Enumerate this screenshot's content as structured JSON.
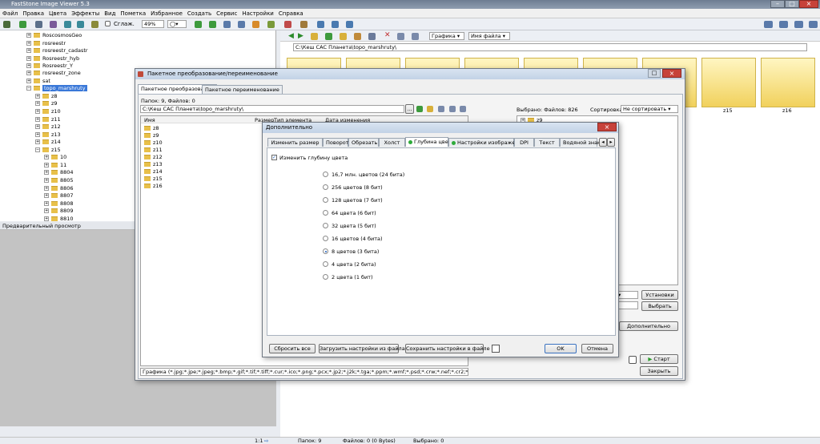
{
  "app": {
    "title": "FastStone Image Viewer 5.3"
  },
  "menu": [
    "Файл",
    "Правка",
    "Цвета",
    "Эффекты",
    "Вид",
    "Пометка",
    "Избранное",
    "Создать",
    "Сервис",
    "Настройки",
    "Справка"
  ],
  "toolbar": {
    "smooth_label": "Сглаж.",
    "zoom_value": "49%"
  },
  "browser": {
    "filter_value": "Графика",
    "sort_value": "Имя файла",
    "path": "C:\\Кеш САС Планета\\topo_marshruty\\"
  },
  "tree": [
    {
      "label": "RoscosmosGeo"
    },
    {
      "label": "rosreestr"
    },
    {
      "label": "rosreestr_cadastr"
    },
    {
      "label": "Rosreestr_hyb"
    },
    {
      "label": "Rosreestr_Y"
    },
    {
      "label": "rosreestr_zone"
    },
    {
      "label": "sat"
    },
    {
      "label": "topo_marshruty"
    },
    {
      "label": "z8"
    },
    {
      "label": "z9"
    },
    {
      "label": "z10"
    },
    {
      "label": "z11"
    },
    {
      "label": "z12"
    },
    {
      "label": "z13"
    },
    {
      "label": "z14"
    },
    {
      "label": "z15"
    },
    {
      "label": "10"
    },
    {
      "label": "11"
    },
    {
      "label": "8804"
    },
    {
      "label": "8805"
    },
    {
      "label": "8806"
    },
    {
      "label": "8807"
    },
    {
      "label": "8808"
    },
    {
      "label": "8809"
    },
    {
      "label": "8810"
    }
  ],
  "preview": {
    "header": "Предварительный просмотр"
  },
  "thumbs": {
    "z15": "z15",
    "z16": "z16"
  },
  "status": {
    "page": "1:1",
    "folders": "Папок: 9",
    "files": "Файлов: 0 (0 Bytes)",
    "selected": "Выбрано: 0"
  },
  "batch": {
    "title": "Пакетное преобразование/переименование",
    "tab_convert": "Пакетное преобразование",
    "tab_rename": "Пакетное переименование",
    "counts": "Папок: 9, Файлов: 0",
    "path": "C:\\Кеш САС Планета\\topo_marshruty\\",
    "col_name": "Имя",
    "col_size": "Размер",
    "col_type": "Тип элемента",
    "col_date": "Дата изменения",
    "files": [
      "z8",
      "z9",
      "z10",
      "z11",
      "z12",
      "z13",
      "z14",
      "z15",
      "z16"
    ],
    "selected": "Выбрано: Файлов: 826",
    "sort_label": "Сортировка:",
    "sort_value": "Не сортировать",
    "right_item": "z9",
    "settings_btn": "Установки",
    "choose_btn": "Выбрать",
    "advanced_btn": "Дополнительно",
    "start_btn": "Старт",
    "close_btn": "Закрыть",
    "filter": "Графика (*.jpg;*.jpe;*.jpeg;*.bmp;*.gif;*.tif;*.tiff;*.cur;*.ico;*.png;*.pcx;*.jp2;*.j2k;*.tga;*.ppm;*.wmf;*.psd;*.crw;*.nef;*.cr2;*.orf;*.raf;*.dng;*"
  },
  "adv": {
    "title": "Дополнительно",
    "tabs": [
      "Изменить размер",
      "Поворот",
      "Обрезать",
      "Холст",
      "Глубина цвета",
      "Настройки изображения",
      "DPI",
      "Текст",
      "Водяной знак"
    ],
    "checkbox_label": "Изменить глубину цвета",
    "options": [
      "16,7 млн. цветов (24 бита)",
      "256 цветов (8 бит)",
      "128 цветов (7 бит)",
      "64 цвета (6 бит)",
      "32 цвета (5 бит)",
      "16 цветов (4 бита)",
      "8 цветов (3 бита)",
      "4 цвета (2 бита)",
      "2 цвета (1 бит)"
    ],
    "selected_option": "8 цветов (3 бита)",
    "btn_reset": "Сбросить все",
    "btn_load": "Загрузить настройки из файла",
    "btn_save": "Сохранить настройки в файле",
    "btn_ok": "OK",
    "btn_cancel": "Отмена"
  },
  "colors": {
    "accent": "#1d5fbf",
    "folder": "#e8c04a",
    "thumb": "#f1d15c",
    "close": "#c7423a",
    "active_dot": "#2eab3a"
  }
}
